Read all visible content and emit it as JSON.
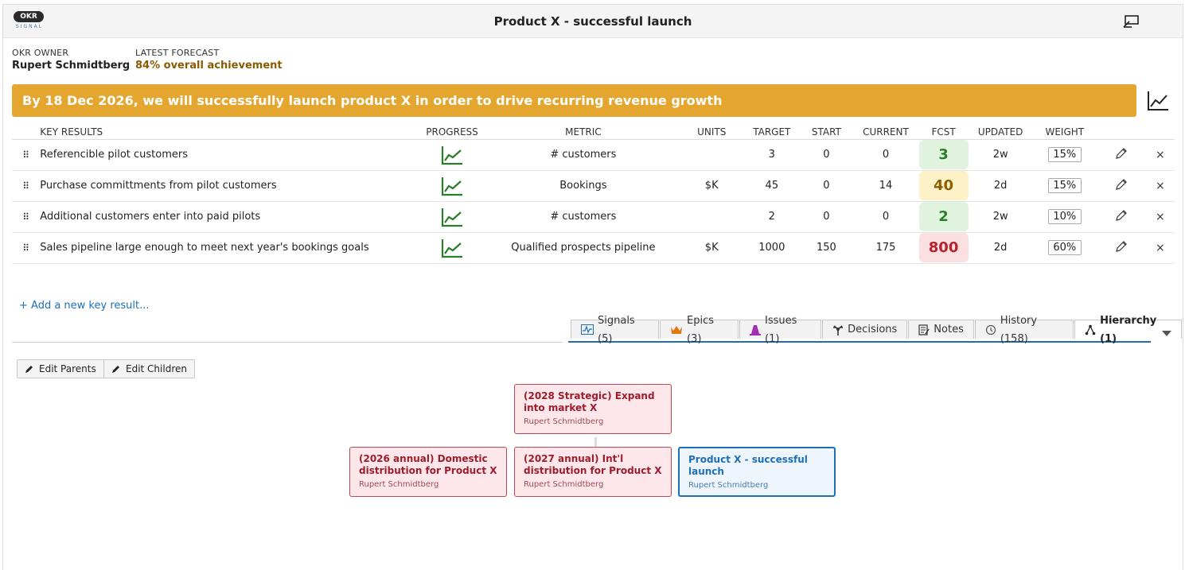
{
  "app": {
    "logo_text": "OKR",
    "logo_sub": "SIGNAL",
    "title": "Product X - successful launch"
  },
  "owner": {
    "label": "OKR OWNER",
    "name": "Rupert Schmidtberg"
  },
  "forecast": {
    "label": "LATEST FORECAST",
    "value": "84% overall achievement",
    "color": "#8a5a00"
  },
  "objective": {
    "text": "By 18 Dec 2026, we will successfully launch product X in order to drive recurring revenue growth",
    "color": "#e5a630"
  },
  "table": {
    "headers": {
      "name": "KEY RESULTS",
      "progress": "PROGRESS",
      "metric": "METRIC",
      "units": "UNITS",
      "target": "TARGET",
      "start": "START",
      "current": "CURRENT",
      "fcst": "FCST",
      "updated": "UPDATED",
      "weight": "WEIGHT"
    },
    "rows": [
      {
        "name": "Referencible pilot customers",
        "metric": "# customers",
        "units": "",
        "target": "3",
        "start": "0",
        "current": "0",
        "fcst": "3",
        "fcst_status": "green",
        "updated": "2w",
        "weight": "15%"
      },
      {
        "name": "Purchase committments from pilot customers",
        "metric": "Bookings",
        "units": "$K",
        "target": "45",
        "start": "0",
        "current": "14",
        "fcst": "40",
        "fcst_status": "yellow",
        "updated": "2d",
        "weight": "15%"
      },
      {
        "name": "Additional customers enter into paid pilots",
        "metric": "# customers",
        "units": "",
        "target": "2",
        "start": "0",
        "current": "0",
        "fcst": "2",
        "fcst_status": "green",
        "updated": "2w",
        "weight": "10%"
      },
      {
        "name": "Sales pipeline large enough to meet next year's bookings goals",
        "metric": "Qualified prospects pipeline",
        "units": "$K",
        "target": "1000",
        "start": "150",
        "current": "175",
        "fcst": "800",
        "fcst_status": "red",
        "updated": "2d",
        "weight": "60%"
      }
    ]
  },
  "status_colors": {
    "green": {
      "bg": "#dff3df",
      "fg": "#2a7d2a"
    },
    "yellow": {
      "bg": "#fdf1c8",
      "fg": "#8a6000"
    },
    "red": {
      "bg": "#fbe0e2",
      "fg": "#b4232f"
    }
  },
  "add_kr": "+ Add a new key result...",
  "tabs": [
    {
      "label": "Signals (5)",
      "icon": "signals-icon"
    },
    {
      "label": "Epics (3)",
      "icon": "crown-icon"
    },
    {
      "label": "Issues (1)",
      "icon": "cone-icon"
    },
    {
      "label": "Decisions",
      "icon": "decision-icon"
    },
    {
      "label": "Notes",
      "icon": "notes-icon"
    },
    {
      "label": "History (158)",
      "icon": "history-icon"
    },
    {
      "label": "Hierarchy (1)",
      "icon": "hierarchy-icon",
      "active": true
    }
  ],
  "buttons": {
    "edit_parents": "Edit Parents",
    "edit_children": "Edit Children"
  },
  "hierarchy": {
    "parent": {
      "title": "(2028 Strategic) Expand into market X",
      "owner": "Rupert Schmidtberg"
    },
    "siblings": [
      {
        "title": "(2026 annual) Domestic distribution for Product X",
        "owner": "Rupert Schmidtberg"
      },
      {
        "title": "(2027 annual) Int'l distribution for Product X",
        "owner": "Rupert Schmidtberg"
      }
    ],
    "self": {
      "title": "Product X - successful launch",
      "owner": "Rupert Schmidtberg"
    }
  }
}
